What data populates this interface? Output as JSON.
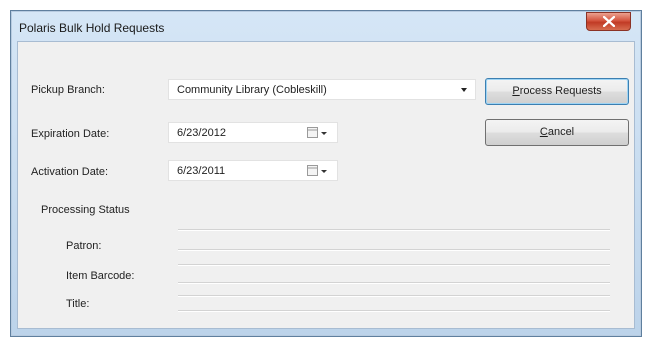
{
  "window": {
    "title": "Polaris Bulk Hold Requests"
  },
  "form": {
    "pickup_branch": {
      "label": "Pickup Branch:",
      "value": "Community Library (Cobleskill)"
    },
    "expiration_date": {
      "label": "Expiration Date:",
      "value": "6/23/2012"
    },
    "activation_date": {
      "label": "Activation Date:",
      "value": "6/23/2011"
    }
  },
  "buttons": {
    "process_prefix": "",
    "process_mnemonic": "P",
    "process_rest": "rocess Requests",
    "cancel_prefix": "",
    "cancel_mnemonic": "C",
    "cancel_rest": "ancel"
  },
  "status": {
    "heading": "Processing Status",
    "patron_label": "Patron:",
    "item_barcode_label": "Item Barcode:",
    "title_label": "Title:"
  }
}
